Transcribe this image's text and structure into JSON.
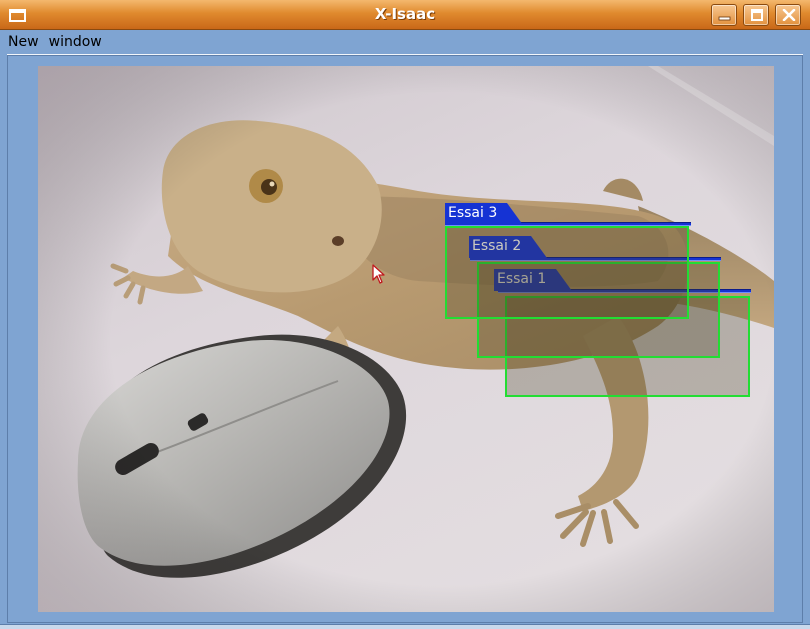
{
  "window": {
    "title": "X-Isaac",
    "icon": "window-icon",
    "buttons": [
      "minimize-icon",
      "maximize-icon",
      "close-icon"
    ]
  },
  "menu": {
    "items": [
      "New",
      "window"
    ]
  },
  "overlay_windows": [
    {
      "label": "Essai 3"
    },
    {
      "label": "Essai 2"
    },
    {
      "label": "Essai 1"
    }
  ],
  "colors": {
    "title_bar": "#e08a2e",
    "background": "#7fa4d2",
    "overlay_border": "#22dd33",
    "overlay_tab": "#1533d4"
  }
}
